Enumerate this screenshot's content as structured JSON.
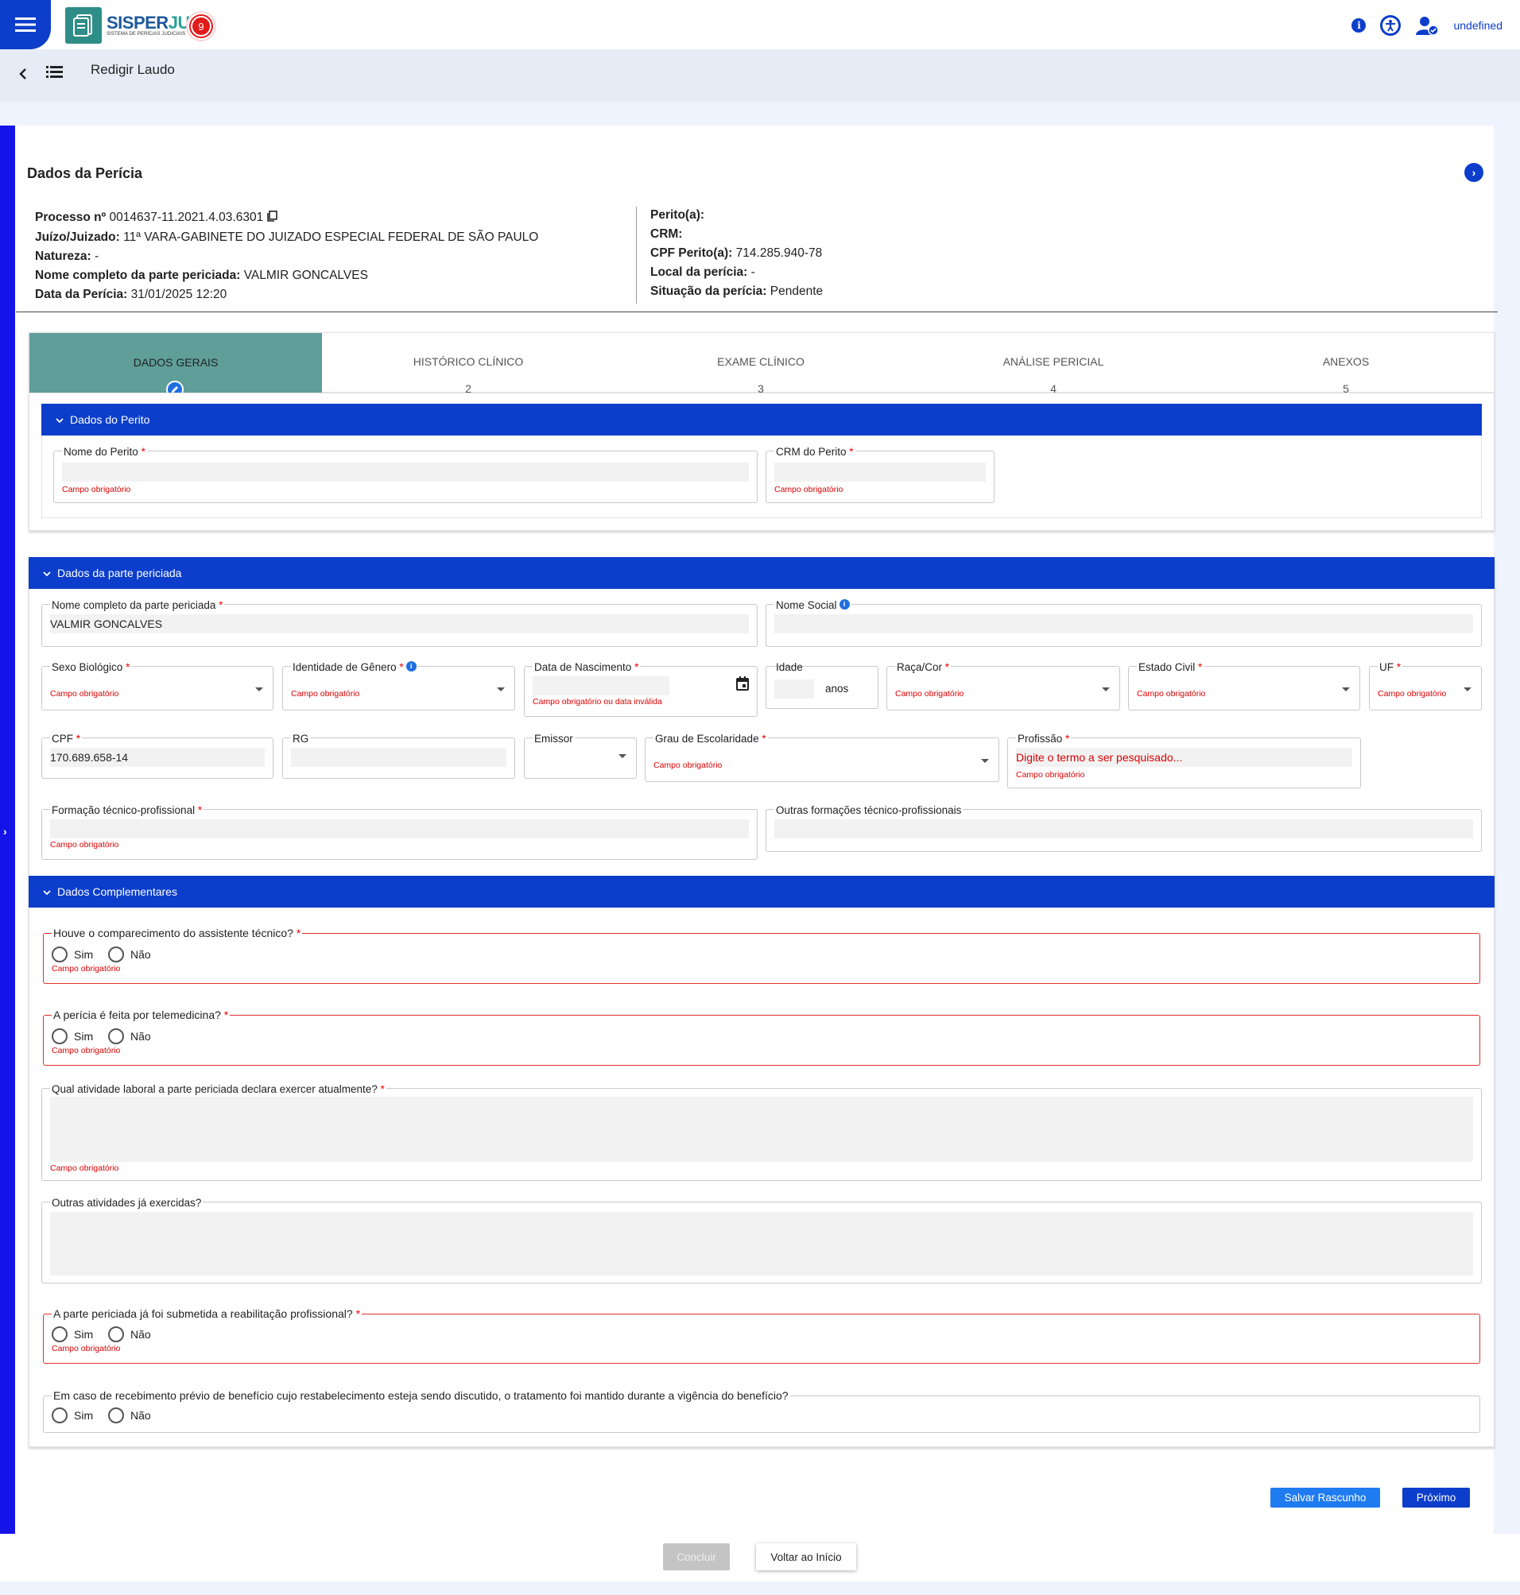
{
  "app": {
    "name": "SISPERJUD",
    "name_part1": "SISPER",
    "name_part2": "JUD",
    "subtitle": "SISTEMA DE PERÍCIAS JUDICIAIS",
    "user": "undefined"
  },
  "header": {
    "title": "Redigir Laudo",
    "badge": "9"
  },
  "page": {
    "title": "Dados da Perícia"
  },
  "info_left": [
    {
      "label": "Processo nº",
      "value": "0014637-11.2021.4.03.6301"
    },
    {
      "label": "Juízo/Juizado:",
      "value": "11ª VARA-GABINETE DO JUIZADO ESPECIAL FEDERAL DE SÃO PAULO"
    },
    {
      "label": "Natureza:",
      "value": "-"
    },
    {
      "label": "Nome completo da parte periciada:",
      "value": "VALMIR GONCALVES"
    },
    {
      "label": "Data da Perícia:",
      "value": "31/01/2025 12:20"
    }
  ],
  "info_right": [
    {
      "label": "Perito(a):",
      "value": ""
    },
    {
      "label": "CRM:",
      "value": ""
    },
    {
      "label": "CPF Perito(a):",
      "value": "714.285.940-78"
    },
    {
      "label": "Local da perícia:",
      "value": "-"
    },
    {
      "label": "Situação da perícia:",
      "value": "Pendente"
    }
  ],
  "steps": [
    {
      "label": "DADOS GERAIS",
      "num": ""
    },
    {
      "label": "HISTÓRICO CLÍNICO",
      "num": "2"
    },
    {
      "label": "EXAME CLÍNICO",
      "num": "3"
    },
    {
      "label": "ANÁLISE PERICIAL",
      "num": "4"
    },
    {
      "label": "ANEXOS",
      "num": "5"
    }
  ],
  "sections": {
    "perito": "Dados do Perito",
    "parte": "Dados da parte periciada",
    "complementares": "Dados Complementares"
  },
  "req": "*",
  "err": {
    "required": "Campo obrigatório",
    "date": "Campo obrigatório ou data inválida"
  },
  "fields": {
    "nome_perito": "Nome do Perito",
    "crm_perito": "CRM do Perito",
    "nome_completo": "Nome completo da parte periciada",
    "nome_completo_value": "VALMIR GONCALVES",
    "nome_social": "Nome Social",
    "sexo": "Sexo Biológico",
    "identidade": "Identidade de Gênero",
    "nascimento": "Data de Nascimento",
    "idade": "Idade",
    "idade_unit": "anos",
    "raca": "Raça/Cor",
    "estado_civil": "Estado Civil",
    "uf": "UF",
    "cpf": "CPF",
    "cpf_value": "170.689.658-14",
    "rg": "RG",
    "emissor": "Emissor",
    "escolaridade": "Grau de Escolaridade",
    "profissao": "Profissão",
    "profissao_placeholder": "Digite o termo a ser pesquisado...",
    "formacao": "Formação técnico-profissional",
    "outras_formacoes": "Outras formações técnico-profissionais"
  },
  "questions": {
    "q1": "Houve o comparecimento do assistente técnico?",
    "q2": "A perícia é feita por telemedicina?",
    "q3": "Qual atividade laboral a parte periciada declara exercer atualmente?",
    "q4": "Outras atividades já exercidas?",
    "q5": "A parte periciada já foi submetida a reabilitação profissional?",
    "q6": "Em caso de recebimento prévio de benefício cujo restabelecimento esteja sendo discutido, o tratamento foi mantido durante a vigência do benefício?",
    "sim": "Sim",
    "nao": "Não"
  },
  "buttons": {
    "salvar": "Salvar Rascunho",
    "proximo": "Próximo",
    "concluir": "Concluir",
    "voltar": "Voltar ao Início"
  },
  "colors": {
    "primary": "#0c3ecb",
    "step_active": "#5f9e99",
    "error": "#d00000"
  }
}
